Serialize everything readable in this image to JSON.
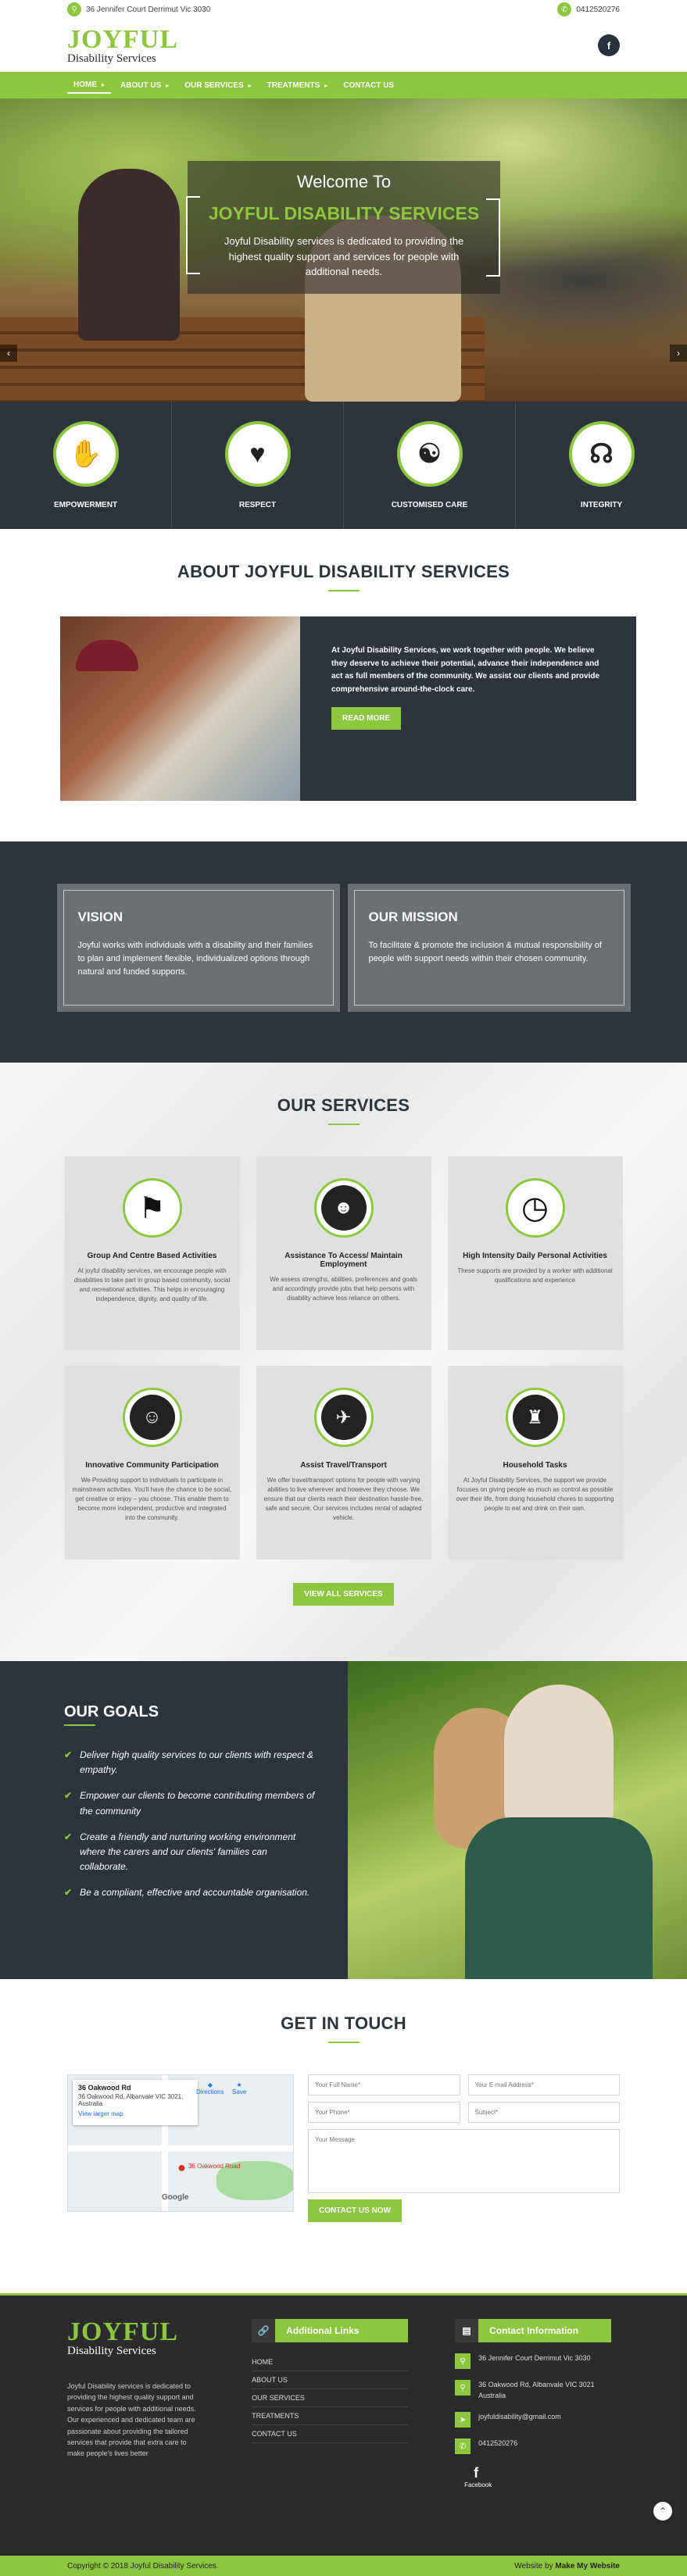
{
  "topbar": {
    "address": "36 Jennifer Court Derrimut Vic 3030",
    "phone": "0412520276",
    "map_icon": "map-marker-icon",
    "phone_icon": "phone-icon"
  },
  "header": {
    "logo_main": "JOYFUL",
    "logo_sub": "Disability Services",
    "social": "f"
  },
  "nav": {
    "items": [
      "HOME",
      "ABOUT US",
      "OUR SERVICES",
      "TREATMENTS",
      "CONTACT US"
    ],
    "active": "HOME"
  },
  "hero": {
    "welcome": "Welcome To",
    "title": "JOYFUL DISABILITY SERVICES",
    "text": "Joyful Disability services is dedicated to providing the highest quality support and services for people with additional needs.",
    "prev": "‹",
    "next": "›"
  },
  "features": [
    {
      "label": "EMPOWERMENT",
      "icon": "sign-language-icon",
      "glyph": "✋"
    },
    {
      "label": "RESPECT",
      "icon": "people-heart-icon",
      "glyph": "♥"
    },
    {
      "label": "CUSTOMISED CARE",
      "icon": "hands-care-icon",
      "glyph": "☯"
    },
    {
      "label": "INTEGRITY",
      "icon": "hearing-icon",
      "glyph": "☊"
    }
  ],
  "about": {
    "title": "ABOUT JOYFUL DISABILITY SERVICES",
    "text": "At Joyful Disability Services, we work together with people. We believe they deserve to achieve their potential, advance their independence and act as full members of the community. We assist our clients and provide comprehensive around-the-clock care.",
    "button": "READ MORE"
  },
  "vision": {
    "title": "VISION",
    "text": "Joyful works with individuals with a disability and their families to plan and implement flexible, individualized options through natural and funded supports."
  },
  "mission": {
    "title": "OUR MISSION",
    "text": "To facilitate & promote the inclusion & mutual responsibility of people with support needs within their chosen community."
  },
  "services": {
    "title": "OUR SERVICES",
    "button": "VIEW ALL SERVICES",
    "items": [
      {
        "title": "Group And Centre Based Activities",
        "icon": "flag-icon",
        "glyph": "⚑",
        "text": "At joyful disability services, we encourage people with disabilities to take part in group based community, social and recreational activities. This helps in encouraging independence, dignity, and quality of life."
      },
      {
        "title": "Assistance To Access/ Maintain Employment",
        "icon": "employee-icon",
        "glyph": "☻",
        "text": "We assess strengths, abilities, preferences and goals and accordingly provide jobs that help persons with disability achieve less reliance on others."
      },
      {
        "title": "High Intensity Daily Personal Activities",
        "icon": "stopwatch-icon",
        "glyph": "◷",
        "text": "These supports are provided by a worker with additional qualifications and experience"
      },
      {
        "title": "Innovative Community Participation",
        "icon": "community-icon",
        "glyph": "☺",
        "text": "We Providing support to individuals to participate in mainstream activities. You'll have the chance to be social, get creative or enjoy – you choose. This enable them to become more independent, productive and integrated into the community."
      },
      {
        "title": "Assist Travel/Transport",
        "icon": "airplane-icon",
        "glyph": "✈",
        "text": "We offer travel/transport options for people with varying abilities to live wherever and however they choose. We ensure that our clients reach their destination hassle-free, safe and secure. Our services includes rental of adapted vehicle."
      },
      {
        "title": "Household Tasks",
        "icon": "chair-icon",
        "glyph": "♜",
        "text": "At Joyful Disability Services, the support we provide focuses on giving people as much as control as possible over their life, from doing household chores to supporting people to eat and drink on their own."
      }
    ]
  },
  "goals": {
    "title": "OUR GOALS",
    "items": [
      "Deliver high quality services to our clients with respect & empathy.",
      "Empower our clients to become contributing members of the community",
      "Create a friendly and nurturing working environment where the carers and our clients' families can collaborate.",
      "Be a compliant, effective and accountable organisation."
    ]
  },
  "touch": {
    "title": "GET IN TOUCH",
    "map": {
      "place": "36 Oakwood Rd",
      "address": "36 Oakwood Rd, Albanvale VIC 3021, Australia",
      "link": "View larger map",
      "pin_label": "36 Oakwood Road",
      "brand": "Google",
      "directions": "Directions",
      "save": "Save"
    },
    "form": {
      "name": "Your Full Name*",
      "email": "Your E-mail Address*",
      "phone": "Your Phone*",
      "subject": "Subject*",
      "message": "Your Message",
      "submit": "CONTACT US NOW"
    }
  },
  "footer": {
    "about": "Joyful Disability services is dedicated to providing the highest quality support and services for people with additional needs. Our experienced and dedicated team are passionate about providing the tailored services that provide that extra care to make people's lives better",
    "links_title": "Additional Links",
    "links": [
      "HOME",
      "ABOUT US",
      "OUR SERVICES",
      "TREATMENTS",
      "CONTACT US"
    ],
    "contact_title": "Contact Information",
    "contact": [
      {
        "icon": "map-marker-icon",
        "glyph": "⚲",
        "text": "36 Jennifer Court Derrimut Vic 3030"
      },
      {
        "icon": "map-marker-icon",
        "glyph": "⚲",
        "text": "36 Oakwood Rd, Albanvale VIC 3021 Australia"
      },
      {
        "icon": "send-icon",
        "glyph": "➤",
        "text": "joyfuldisability@gmail.com"
      },
      {
        "icon": "phone-icon",
        "glyph": "✆",
        "text": "0412520276"
      }
    ],
    "facebook": "Facebook"
  },
  "bottom": {
    "copyright": "Copyright © 2018 Joyful Disability Services.",
    "credit": "Website by",
    "credit_brand": "Make My Website"
  },
  "colors": {
    "accent": "#8dc63f",
    "dark": "#2e343c"
  }
}
